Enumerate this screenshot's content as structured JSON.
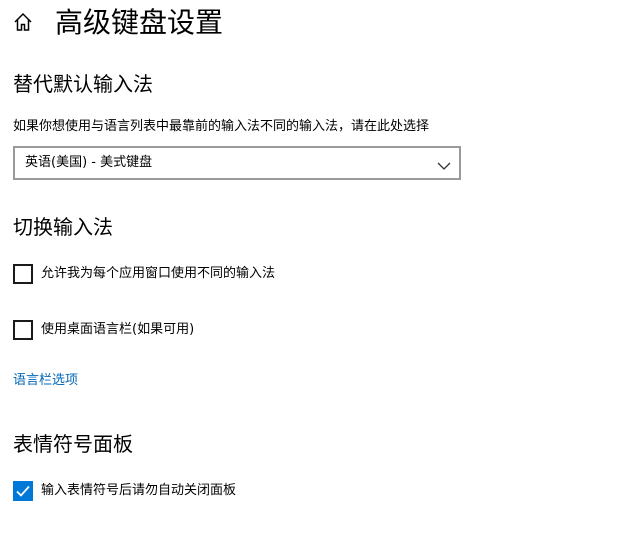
{
  "header": {
    "home_icon": "home-icon",
    "title": "高级键盘设置"
  },
  "default_input": {
    "heading": "替代默认输入法",
    "description": "如果你想使用与语言列表中最靠前的输入法不同的输入法，请在此处选择",
    "dropdown_value": "英语(美国) - 美式键盘"
  },
  "switch_input": {
    "heading": "切换输入法",
    "option_per_window": {
      "label": "允许我为每个应用窗口使用不同的输入法",
      "checked": false
    },
    "option_language_bar": {
      "label": "使用桌面语言栏(如果可用)",
      "checked": false
    },
    "language_bar_link": "语言栏选项"
  },
  "emoji_panel": {
    "heading": "表情符号面板",
    "option_auto_close": {
      "label": "输入表情符号后请勿自动关闭面板",
      "checked": true
    }
  },
  "colors": {
    "accent": "#0078d7",
    "link": "#0067b8"
  }
}
